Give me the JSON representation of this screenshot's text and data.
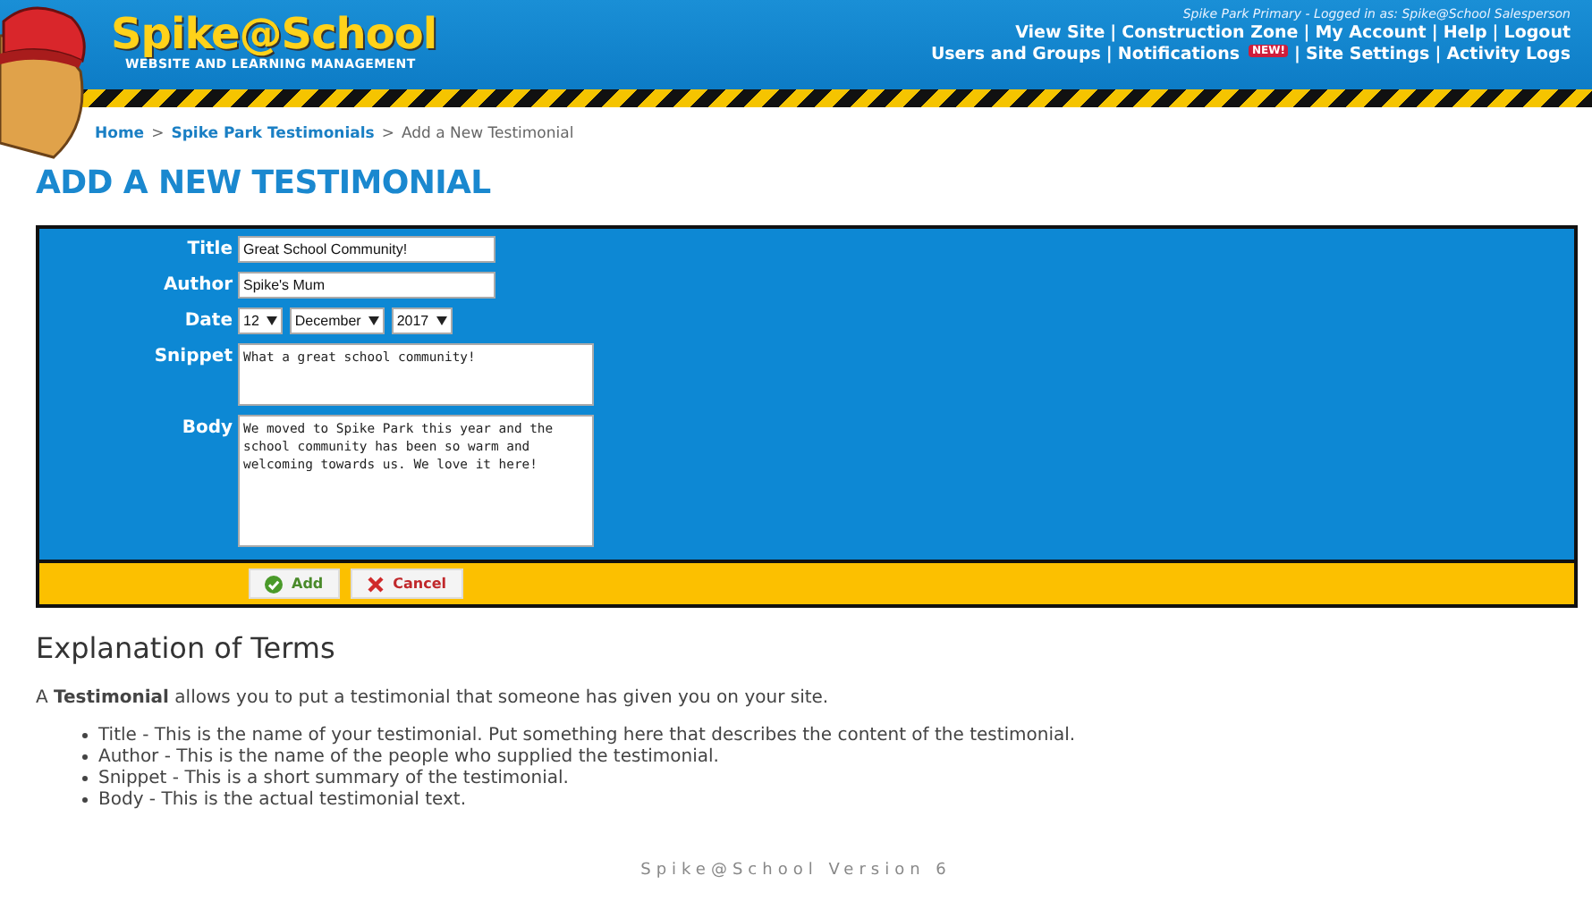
{
  "header": {
    "logo": {
      "name": "Spike@School",
      "tagline": "WEBSITE AND LEARNING MANAGEMENT"
    },
    "login_info": "Spike Park Primary - Logged in as: Spike@School Salesperson",
    "separator": "|",
    "nav_rows": [
      [
        {
          "label": "View Site"
        },
        {
          "label": "Construction Zone"
        },
        {
          "label": "My Account"
        },
        {
          "label": "Help"
        },
        {
          "label": "Logout"
        }
      ],
      [
        {
          "label": "Users and Groups"
        },
        {
          "label": "Notifications",
          "badge": "NEW!"
        },
        {
          "label": "Site Settings"
        },
        {
          "label": "Activity Logs"
        }
      ]
    ]
  },
  "breadcrumb": {
    "links": [
      "Home",
      "Spike Park Testimonials"
    ],
    "separator": ">",
    "current": "Add a New Testimonial"
  },
  "page_title": "ADD A NEW TESTIMONIAL",
  "form": {
    "fields": [
      {
        "kind": "text",
        "label": "Title",
        "value": "Great School Community!"
      },
      {
        "kind": "text",
        "label": "Author",
        "value": "Spike's Mum"
      },
      {
        "kind": "date",
        "label": "Date",
        "parts": [
          "12",
          "December",
          "2017"
        ]
      },
      {
        "kind": "short_textarea",
        "label": "Snippet",
        "value": "What a great school community!"
      },
      {
        "kind": "textarea",
        "label": "Body",
        "value": "We moved to Spike Park this year and the school community has been so warm and welcoming towards us. We love it here!"
      }
    ],
    "buttons": [
      {
        "kind": "confirm",
        "label": "Add"
      },
      {
        "kind": "cancel",
        "label": "Cancel"
      }
    ]
  },
  "explanation": {
    "heading": "Explanation of Terms",
    "intro": "A **Testimonial** allows you to put a testimonial that someone has given you on your site.",
    "items": [
      "Title - This is the name of your testimonial. Put something here that describes the content of the testimonial.",
      "Author - This is the name of the people who supplied the testimonial.",
      "Snippet - This is a short summary of the testimonial.",
      "Body - This is the actual testimonial text."
    ]
  },
  "footer": "Spike@School Version 6"
}
